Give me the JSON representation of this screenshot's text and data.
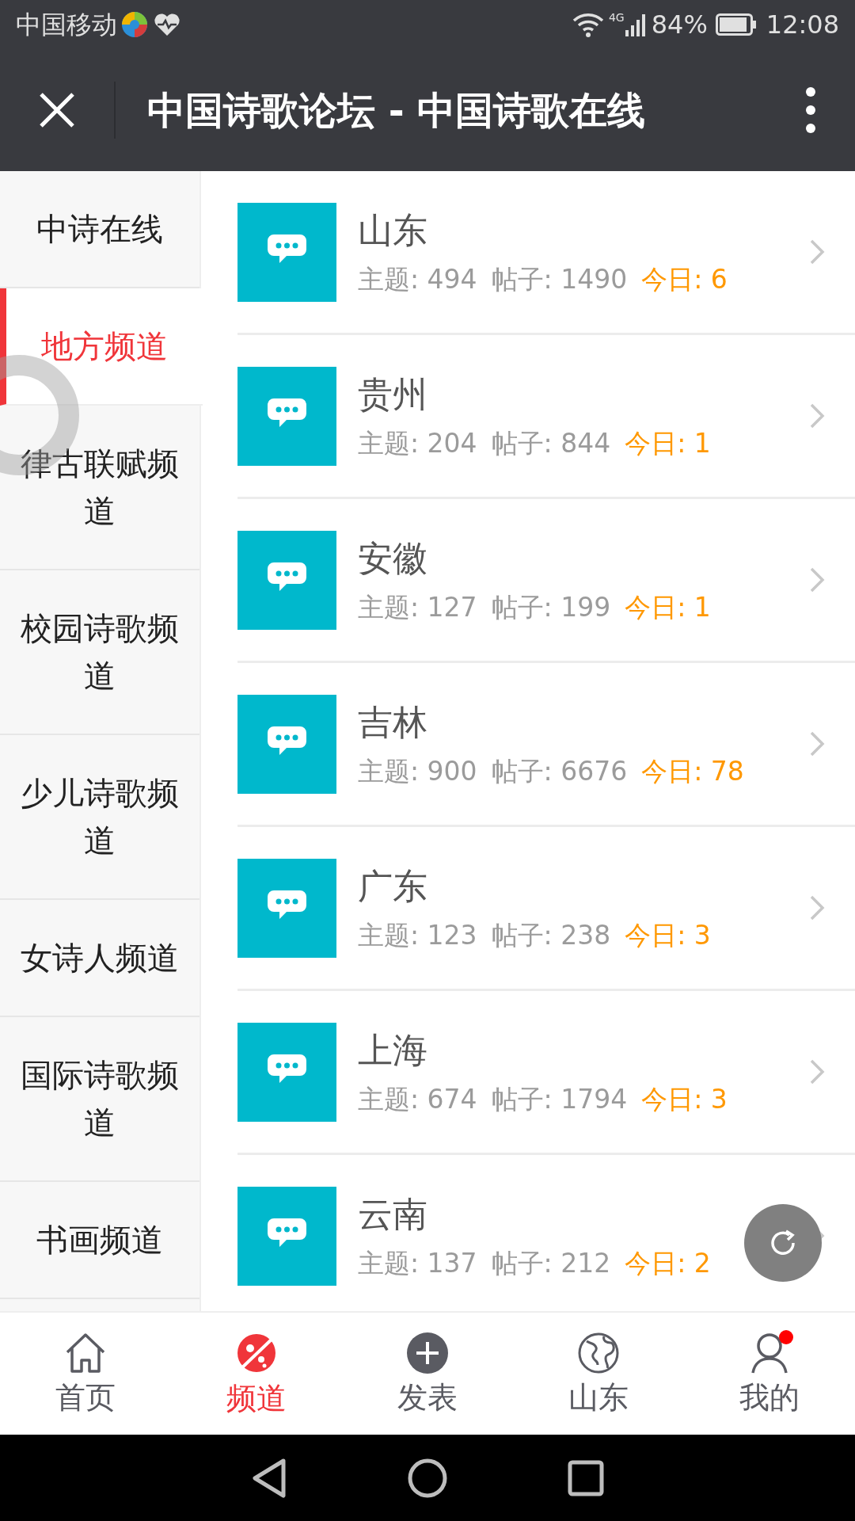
{
  "status_bar": {
    "carrier": "中国移动",
    "network": "4G",
    "battery": "84%",
    "time": "12:08"
  },
  "app_bar": {
    "title": "中国诗歌论坛 - 中国诗歌在线"
  },
  "sidebar": {
    "items": [
      {
        "label": "中诗在线",
        "selected": false
      },
      {
        "label": "地方频道",
        "selected": true
      },
      {
        "label": "律古联赋频道",
        "selected": false
      },
      {
        "label": "校园诗歌频道",
        "selected": false
      },
      {
        "label": "少儿诗歌频道",
        "selected": false
      },
      {
        "label": "女诗人频道",
        "selected": false
      },
      {
        "label": "国际诗歌频道",
        "selected": false
      },
      {
        "label": "书画频道",
        "selected": false
      }
    ]
  },
  "forums": [
    {
      "name": "山东",
      "stats": [
        {
          "kind": "count",
          "text": "主题: 494"
        },
        {
          "kind": "count",
          "text": "帖子: 1490"
        },
        {
          "kind": "today",
          "text": "今日: 6"
        }
      ]
    },
    {
      "name": "贵州",
      "stats": [
        {
          "kind": "count",
          "text": "主题: 204"
        },
        {
          "kind": "count",
          "text": "帖子: 844"
        },
        {
          "kind": "today",
          "text": "今日: 1"
        }
      ]
    },
    {
      "name": "安徽",
      "stats": [
        {
          "kind": "count",
          "text": "主题: 127"
        },
        {
          "kind": "count",
          "text": "帖子: 199"
        },
        {
          "kind": "today",
          "text": "今日: 1"
        }
      ]
    },
    {
      "name": "吉林",
      "stats": [
        {
          "kind": "count",
          "text": "主题: 900"
        },
        {
          "kind": "count",
          "text": "帖子: 6676"
        },
        {
          "kind": "today",
          "text": "今日: 78"
        }
      ]
    },
    {
      "name": "广东",
      "stats": [
        {
          "kind": "count",
          "text": "主题: 123"
        },
        {
          "kind": "count",
          "text": "帖子: 238"
        },
        {
          "kind": "today",
          "text": "今日: 3"
        }
      ]
    },
    {
      "name": "上海",
      "stats": [
        {
          "kind": "count",
          "text": "主题: 674"
        },
        {
          "kind": "count",
          "text": "帖子: 1794"
        },
        {
          "kind": "today",
          "text": "今日: 3"
        }
      ]
    },
    {
      "name": "云南",
      "stats": [
        {
          "kind": "count",
          "text": "主题: 137"
        },
        {
          "kind": "count",
          "text": "帖子: 212"
        },
        {
          "kind": "today",
          "text": "今日: 2"
        }
      ]
    }
  ],
  "bottom_nav": [
    {
      "kind": "home",
      "label": "首页",
      "selected": false,
      "badge": false
    },
    {
      "kind": "channels",
      "label": "频道",
      "selected": true,
      "badge": false
    },
    {
      "kind": "post",
      "label": "发表",
      "selected": false,
      "badge": false
    },
    {
      "kind": "globe",
      "label": "山东",
      "selected": false,
      "badge": false
    },
    {
      "kind": "profile",
      "label": "我的",
      "selected": false,
      "badge": true
    }
  ]
}
